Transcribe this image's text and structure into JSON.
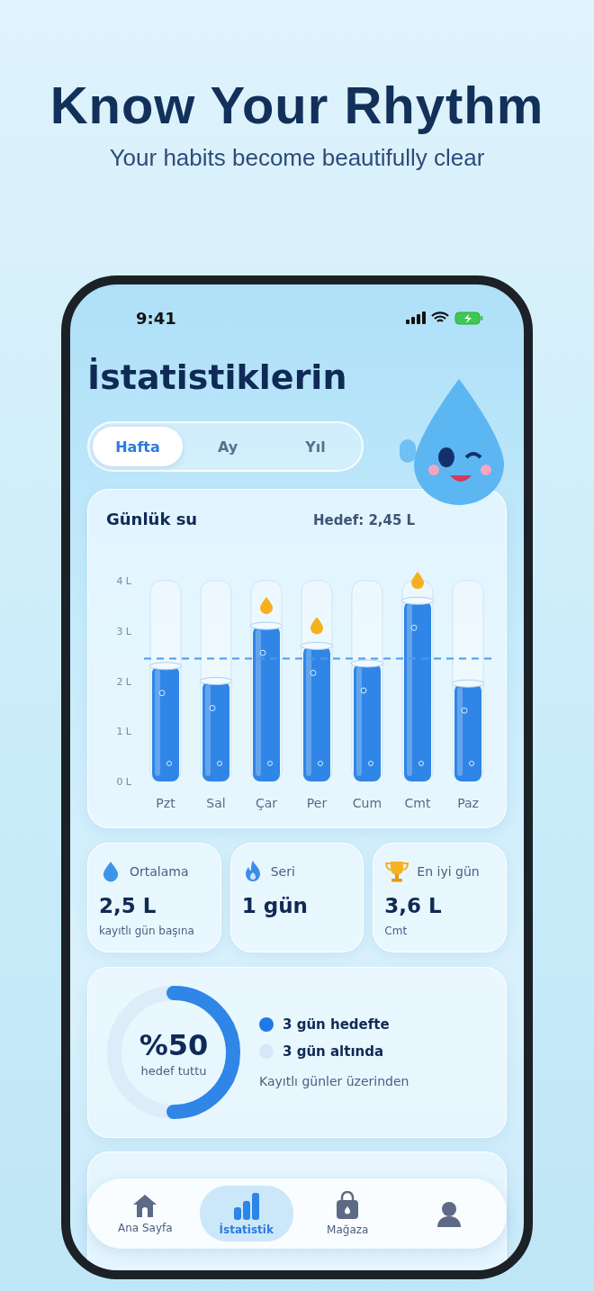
{
  "headline": {
    "title": "Know Your Rhythm",
    "subtitle": "Your habits become beautifully clear"
  },
  "status_bar": {
    "time": "9:41"
  },
  "screen_title": "İstatistiklerin",
  "tabs": [
    {
      "label": "Hafta",
      "selected": true
    },
    {
      "label": "Ay",
      "selected": false
    },
    {
      "label": "Yıl",
      "selected": false
    }
  ],
  "daily_card": {
    "title": "Günlük su",
    "goal": "Hedef: 2,45 L",
    "chart_data": {
      "type": "bar",
      "categories": [
        "Pzt",
        "Sal",
        "Çar",
        "Per",
        "Cum",
        "Cmt",
        "Paz"
      ],
      "values": [
        2.3,
        2.0,
        3.1,
        2.7,
        2.35,
        3.6,
        1.95
      ],
      "ylim": [
        0,
        4
      ],
      "yticks": [
        {
          "value": 0,
          "label": "0 L"
        },
        {
          "value": 1,
          "label": "1 L"
        },
        {
          "value": 2,
          "label": "2 L"
        },
        {
          "value": 3,
          "label": "3 L"
        },
        {
          "value": 4,
          "label": "4 L"
        }
      ],
      "ref_lines": [
        {
          "axis": "y",
          "value": 2.45
        }
      ]
    }
  },
  "stats": [
    {
      "kind": "average",
      "label": "Ortalama",
      "value": "2,5 L",
      "note": "kayıtlı gün başına"
    },
    {
      "kind": "streak",
      "label": "Seri",
      "value": "1 gün"
    },
    {
      "kind": "best",
      "label": "En iyi gün",
      "value": "3,6 L",
      "note": "Cmt"
    }
  ],
  "goal_card": {
    "percent": "%50",
    "caption": "hedef tuttu",
    "level": 0.5,
    "legend": [
      {
        "label": "3 gün hedefte",
        "color": "#1f7ae8"
      },
      {
        "label": "3 gün altında",
        "color": "#d6e8f8"
      }
    ],
    "note": "Kayıtlı günler üzerinden"
  },
  "nav": [
    {
      "kind": "home",
      "label": "Ana Sayfa",
      "selected": false
    },
    {
      "kind": "stats",
      "label": "İstatistik",
      "selected": true
    },
    {
      "kind": "shop",
      "label": "Mağaza",
      "selected": false
    },
    {
      "kind": "profile",
      "selected": false
    }
  ]
}
